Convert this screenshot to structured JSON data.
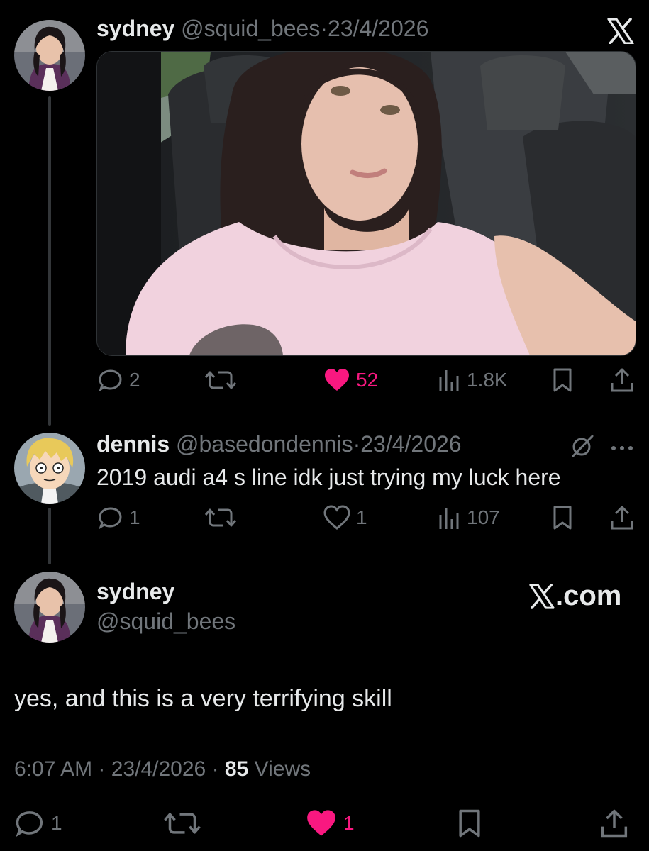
{
  "post1": {
    "name": "sydney",
    "handle": "@squid_bees",
    "sep": "·",
    "date": "23/4/2026",
    "replies": "2",
    "likes": "52",
    "views": "1.8K"
  },
  "post2": {
    "name": "dennis",
    "handle": "@basedondennis",
    "sep": "·",
    "date": "23/4/2026",
    "text": "2019 audi a4 s line idk just trying my luck here",
    "replies": "1",
    "likes": "1",
    "views": "107"
  },
  "post3": {
    "name": "sydney",
    "handle": "@squid_bees",
    "brand": "X.com",
    "text": "yes, and this is a very terrifying skill",
    "time": "6:07 AM",
    "sep": "·",
    "date": "23/4/2026",
    "views_count": "85",
    "views_label": "Views",
    "replies": "1",
    "likes": "1"
  },
  "colors": {
    "background": "#000000",
    "text": "#e7e9ea",
    "muted": "#71767b",
    "like": "#f91880"
  },
  "icons": [
    "x-logo-icon",
    "reply-icon",
    "retweet-icon",
    "heart-icon",
    "views-icon",
    "bookmark-icon",
    "share-icon",
    "grok-icon",
    "more-icon"
  ]
}
